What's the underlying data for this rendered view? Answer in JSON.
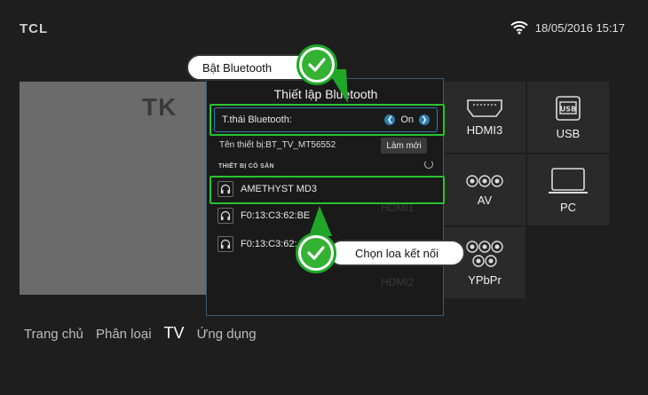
{
  "header": {
    "logo": "TCL",
    "datetime": "18/05/2016 15:17",
    "wifi_icon": "wifi-icon"
  },
  "preview": {
    "logo_text": "TK"
  },
  "sources": [
    {
      "label": "HDMI3",
      "icon": "hdmi-icon"
    },
    {
      "label": "USB",
      "icon": "usb-icon"
    },
    {
      "label": "AV",
      "icon": "av-icon"
    },
    {
      "label": "PC",
      "icon": "pc-icon"
    },
    {
      "label": "YPbPr",
      "icon": "ypbpr-icon"
    }
  ],
  "bluetooth_dialog": {
    "title": "Thiết lập Bluetooth",
    "status_label": "T.thái Bluetooth:",
    "status_value": "On",
    "device_name": "Tên thiết bị:BT_TV_MT56552",
    "refresh_label": "Làm mới",
    "section_label": "THIẾT BỊ CÓ SẴN",
    "devices": [
      {
        "name": "AMETHYST MD3"
      },
      {
        "name": "F0:13:C3:62:BE"
      },
      {
        "name": "F0:13:C3:62:"
      }
    ]
  },
  "ghost_labels": {
    "hdmi1": "HDMI1",
    "hdmi2": "HDMI2"
  },
  "callouts": {
    "enable_bluetooth": "Bật Bluetooth",
    "choose_speaker": "Chọn loa kết nối"
  },
  "nav": [
    {
      "label": "Trang chủ",
      "active": false
    },
    {
      "label": "Phân loại",
      "active": false
    },
    {
      "label": "TV",
      "active": true
    },
    {
      "label": "Ứng dụng",
      "active": false
    }
  ],
  "colors": {
    "highlight": "#27c42e",
    "accent": "#2e7fb0"
  }
}
